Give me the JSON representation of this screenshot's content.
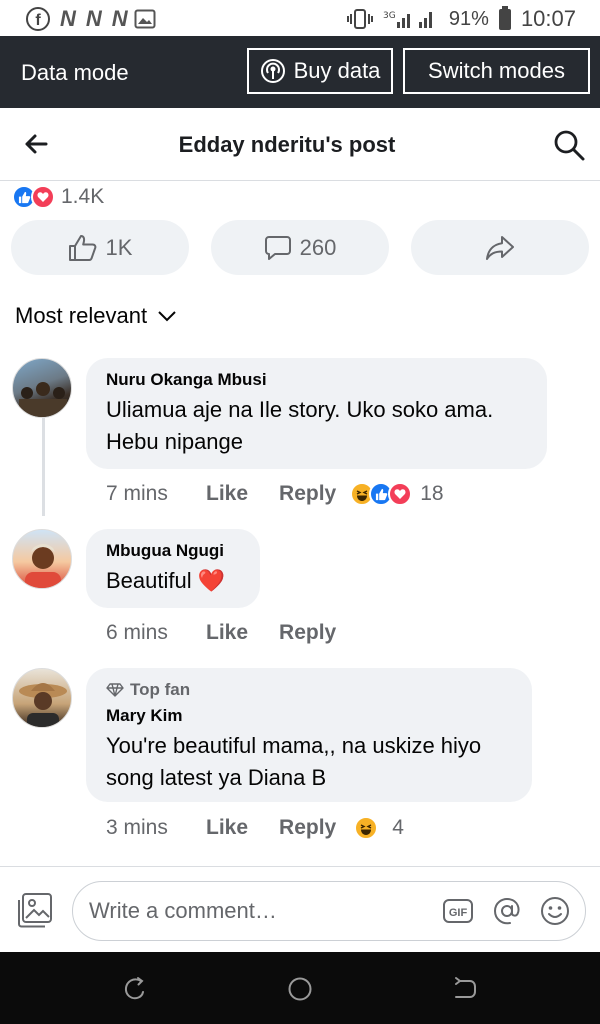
{
  "status_bar": {
    "battery": "91%",
    "time": "10:07",
    "network": "3G"
  },
  "banner": {
    "title": "Data mode",
    "buy_data": "Buy data",
    "switch_modes": "Switch modes"
  },
  "header": {
    "title": "Edday nderitu's post"
  },
  "reactions": {
    "total": "1.4K"
  },
  "actions": {
    "like_count": "1K",
    "comment_count": "260"
  },
  "sort": {
    "label": "Most relevant"
  },
  "comments": [
    {
      "author": "Nuru Okanga Mbusi",
      "text": "Uliamua aje na Ile story. Uko soko ama. Hebu nipange",
      "time": "7 mins",
      "like": "Like",
      "reply": "Reply",
      "reaction_count": "18",
      "reactions": [
        "haha",
        "like",
        "love"
      ]
    },
    {
      "author": "Mbugua Ngugi",
      "text": "Beautiful ",
      "emoji": "❤️",
      "time": "6 mins",
      "like": "Like",
      "reply": "Reply"
    },
    {
      "badge": "Top fan",
      "author": "Mary Kim",
      "text": "You're beautiful mama,, na uskize hiyo song latest ya Diana B",
      "time": "3 mins",
      "like": "Like",
      "reply": "Reply",
      "reaction_count": "4",
      "reactions": [
        "haha"
      ]
    }
  ],
  "composer": {
    "placeholder": "Write a comment…"
  },
  "colors": {
    "banner": "#262a30",
    "like_blue": "#1877f2",
    "love_red": "#f33e58",
    "bubble_bg": "#f0f2f5",
    "muted": "#65676b"
  }
}
